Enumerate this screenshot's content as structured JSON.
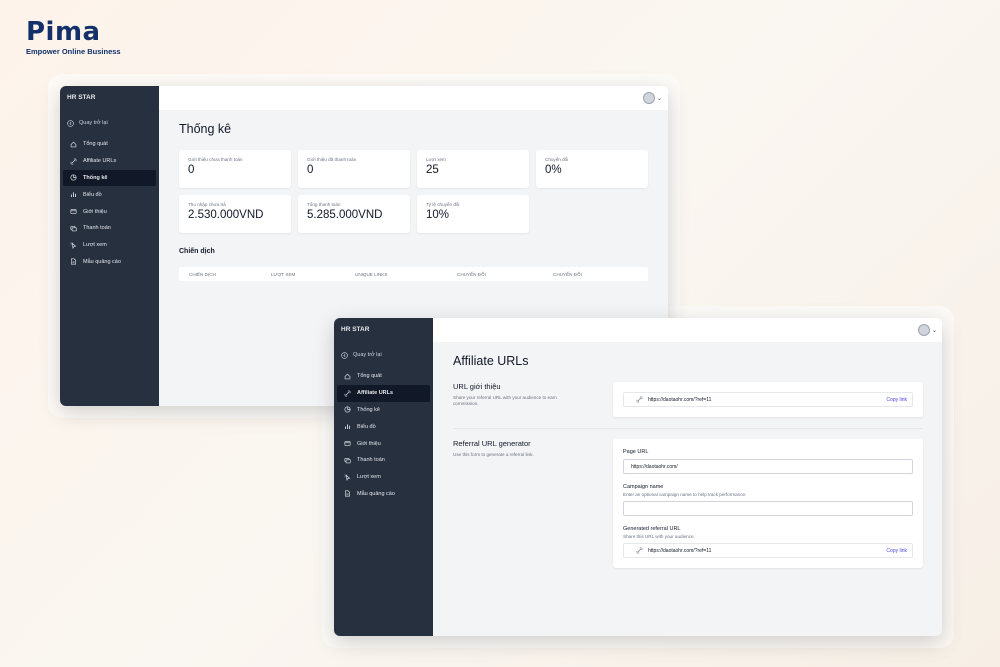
{
  "logo": {
    "name": "Pima",
    "tagline": "Empower Online Business"
  },
  "colors": {
    "sidebar": "#27303f",
    "brand": "#13306b",
    "accent": "#f47b20",
    "link": "#4f46e5"
  },
  "back_window": {
    "brand": "HR STAR",
    "back_label": "Quay trở lại",
    "nav": [
      {
        "label": "Tổng quát",
        "icon": "home-icon"
      },
      {
        "label": "Affiliate URLs",
        "icon": "link-icon"
      },
      {
        "label": "Thống kê",
        "icon": "chart-pie-icon",
        "active": true
      },
      {
        "label": "Biểu đồ",
        "icon": "bar-chart-icon"
      },
      {
        "label": "Giới thiệu",
        "icon": "card-icon"
      },
      {
        "label": "Thanh toán",
        "icon": "payment-icon"
      },
      {
        "label": "Lượt xem",
        "icon": "cursor-icon"
      },
      {
        "label": "Mẫu quảng cáo",
        "icon": "document-icon"
      }
    ],
    "title": "Thống kê",
    "stats_row1": [
      {
        "label": "Giới thiệu chưa thanh toán",
        "value": "0"
      },
      {
        "label": "Giới thiệu đã thanh toán",
        "value": "0"
      },
      {
        "label": "Lượt xem",
        "value": "25"
      },
      {
        "label": "Chuyển đổi",
        "value": "0%"
      }
    ],
    "stats_row2": [
      {
        "label": "Thu nhập chưa trả",
        "value": "2.530.000VND"
      },
      {
        "label": "Tổng thanh toán",
        "value": "5.285.000VND"
      },
      {
        "label": "Tỷ lệ chuyển đổi",
        "value": "10%"
      }
    ],
    "campaign_title": "Chiến dịch",
    "campaign_columns": [
      "CHIẾN DỊCH",
      "LƯỢT XEM",
      "UNIQUE LINKS",
      "CHUYỂN ĐỔI",
      "CHUYỂN ĐỔI"
    ]
  },
  "front_window": {
    "brand": "HR STAR",
    "back_label": "Quay trở lại",
    "nav": [
      {
        "label": "Tổng quát",
        "icon": "home-icon"
      },
      {
        "label": "Affiliate URLs",
        "icon": "link-icon",
        "active": true
      },
      {
        "label": "Thống kê",
        "icon": "chart-pie-icon"
      },
      {
        "label": "Biểu đồ",
        "icon": "bar-chart-icon"
      },
      {
        "label": "Giới thiệu",
        "icon": "card-icon"
      },
      {
        "label": "Thanh toán",
        "icon": "payment-icon"
      },
      {
        "label": "Lượt xem",
        "icon": "cursor-icon"
      },
      {
        "label": "Mẫu quảng cáo",
        "icon": "document-icon"
      }
    ],
    "title": "Affiliate URLs",
    "referral": {
      "title": "URL giới thiệu",
      "desc": "Share your referral URL with your audience to earn commission.",
      "url": "https://daotaohr.com/?ref=11",
      "copy": "Copy link"
    },
    "generator": {
      "title": "Referral URL generator",
      "desc": "Use this form to generate a referral link.",
      "page_url_label": "Page URL",
      "page_url_value": "https://daotaohr.com/",
      "campaign_label": "Campaign name",
      "campaign_hint": "Enter an optional campaign name to help track performance.",
      "campaign_value": "",
      "generated_label": "Generated referral URL",
      "generated_hint": "Share this URL with your audience.",
      "generated_value": "https://daotaohr.com/?ref=11",
      "copy": "Copy link"
    }
  }
}
